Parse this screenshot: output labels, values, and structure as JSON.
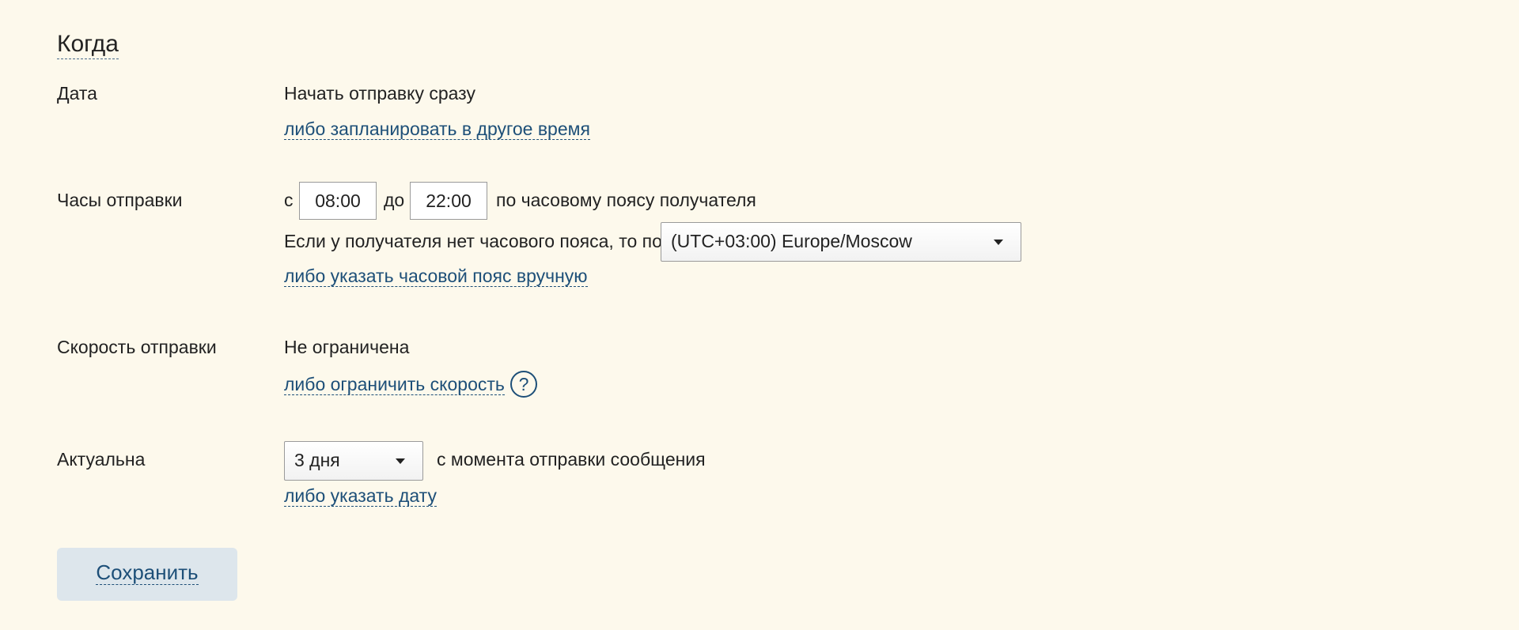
{
  "section": {
    "title": "Когда"
  },
  "date": {
    "label": "Дата",
    "value": "Начать отправку сразу",
    "alt_link": "либо запланировать в другое время"
  },
  "hours": {
    "label": "Часы отправки",
    "from_label": "с",
    "from_value": "08:00",
    "to_label": "до",
    "to_value": "22:00",
    "suffix": "по часовому поясу получателя",
    "fallback_text": "Если у получателя нет часового пояса, то по",
    "timezone_selected": "(UTC+03:00) Europe/Moscow",
    "alt_link": "либо указать часовой пояс вручную"
  },
  "speed": {
    "label": "Скорость отправки",
    "value": "Не ограничена",
    "alt_link": "либо ограничить скорость",
    "help_symbol": "?"
  },
  "relevance": {
    "label": "Актуальна",
    "duration_selected": "3 дня",
    "suffix": "с момента отправки сообщения",
    "alt_link": "либо указать дату"
  },
  "actions": {
    "save_label": "Сохранить"
  },
  "icons": {
    "dropdown": "caret-down-icon",
    "help": "question-circle-icon"
  },
  "colors": {
    "background": "#fdf9ec",
    "link": "#1d4f78",
    "button_bg": "#dde6ec"
  }
}
